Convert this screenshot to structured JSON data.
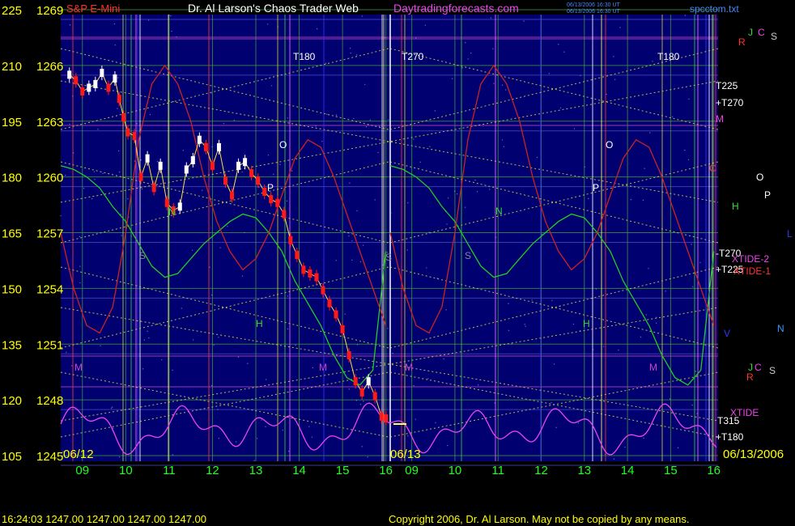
{
  "header": {
    "series_label": "S&P E-Mini",
    "title": "Dr. Al Larson's Chaos Trader Web",
    "site": "Daytradingforecasts.com",
    "stamp_1": "06/13/2006 16:30 UT",
    "stamp_2": "06/13/2006 16:30 UT",
    "file": "spcctom.txt"
  },
  "footer": {
    "quote": "16:24:03  1247.00 1247.00 1247.00 1247.00",
    "copyright": "Copyright 2006, Dr. Al Larson. May not be copied by any means."
  },
  "colors": {
    "background": "#000000",
    "plot_bg": "#000070",
    "price_up": "#ffffff",
    "price_down": "#ff1a1a",
    "electric_green": "#22cc22",
    "electric_red": "#cc2222",
    "tide_magenta": "#ee44ee",
    "grid_gold": "#d8d840",
    "day_boundary": "#ffffff",
    "axis_left_text": "#ffff00",
    "axis_bottom_text": "#22ff22"
  },
  "chart_data": {
    "type": "line",
    "title": "Dr. Al Larson's Chaos Trader Web",
    "subtitle": "S&P E-Mini",
    "y_left_ticks": [
      "225",
      "210",
      "195",
      "180",
      "165",
      "150",
      "135",
      "120",
      "105"
    ],
    "y_right_ticks": [
      "1269",
      "1266",
      "1263",
      "1260",
      "1257",
      "1254",
      "1251",
      "1248",
      "1245"
    ],
    "ylim_price": [
      1245,
      1269
    ],
    "ylim_scale": [
      105,
      225
    ],
    "x_hour_ticks": [
      "09",
      "10",
      "11",
      "12",
      "13",
      "14",
      "15",
      "16",
      "09",
      "10",
      "11",
      "12",
      "13",
      "14",
      "15",
      "16"
    ],
    "x_range_hours": [
      8.5,
      16.1
    ],
    "days": [
      "06/12",
      "06/13",
      "06/13/2006"
    ],
    "series": [
      {
        "name": "S&P E-Mini",
        "x_hours": [
          8.7,
          8.85,
          9.0,
          9.15,
          9.3,
          9.45,
          9.6,
          9.75,
          9.85,
          9.95,
          10.05,
          10.2,
          10.35,
          10.5,
          10.65,
          10.8,
          10.95,
          11.1,
          11.25,
          11.4,
          11.55,
          11.7,
          11.85,
          12.0,
          12.15,
          12.3,
          12.45,
          12.6,
          12.75,
          12.9,
          13.05,
          13.2,
          13.35,
          13.5,
          13.65,
          13.8,
          13.95,
          14.1,
          14.25,
          14.4,
          14.55,
          14.7,
          14.85,
          15.0,
          15.15,
          15.3,
          15.45,
          15.6,
          15.75,
          15.9,
          16.0
        ],
        "values": [
          1265.5,
          1265.2,
          1264.6,
          1264.8,
          1265.0,
          1265.6,
          1264.8,
          1265.3,
          1264.2,
          1263.2,
          1262.4,
          1262.2,
          1260.0,
          1261.0,
          1259.4,
          1260.6,
          1258.6,
          1258.2,
          1258.4,
          1260.4,
          1260.9,
          1262.0,
          1261.6,
          1260.6,
          1261.6,
          1259.8,
          1259.0,
          1260.6,
          1260.8,
          1260.2,
          1259.8,
          1259.2,
          1258.8,
          1258.6,
          1258.0,
          1256.6,
          1255.8,
          1255.0,
          1254.8,
          1254.6,
          1253.9,
          1253.2,
          1252.6,
          1251.8,
          1250.4,
          1249.0,
          1248.4,
          1249.0,
          1248.2,
          1247.1,
          1247.0
        ]
      },
      {
        "name": "Electric field (green)",
        "x_hours": [
          8.5,
          8.8,
          9.1,
          9.4,
          9.7,
          10.0,
          10.3,
          10.6,
          10.9,
          11.2,
          11.5,
          11.8,
          12.1,
          12.4,
          12.7,
          13.0,
          13.3,
          13.6,
          13.9,
          14.2,
          14.5,
          14.8,
          15.1,
          15.4,
          15.7,
          16.0
        ],
        "values": [
          183,
          182,
          180,
          177,
          172,
          168,
          162,
          156,
          153,
          154,
          158,
          162,
          165,
          168,
          170,
          169,
          165,
          160,
          152,
          146,
          140,
          132,
          126,
          124,
          128,
          160
        ]
      },
      {
        "name": "Electric field (red)",
        "x_hours": [
          8.5,
          8.8,
          9.1,
          9.4,
          9.7,
          10.0,
          10.3,
          10.6,
          10.9,
          11.2,
          11.5,
          11.8,
          12.1,
          12.4,
          12.7,
          13.0,
          13.3,
          13.6,
          13.9,
          14.2,
          14.5,
          14.8,
          15.1,
          15.4,
          15.7,
          16.0
        ],
        "values": [
          165,
          150,
          140,
          138,
          145,
          165,
          190,
          205,
          210,
          205,
          195,
          180,
          168,
          160,
          155,
          158,
          165,
          175,
          185,
          190,
          188,
          180,
          170,
          160,
          150,
          140
        ]
      }
    ],
    "annotations": [
      "T180",
      "T270",
      "T180",
      "T225",
      "+T270",
      "-T270",
      "+T225",
      "T315",
      "+T180",
      "M",
      "C",
      "O",
      "P",
      "H",
      "N",
      "S",
      "R",
      "J",
      "V",
      "L",
      "XTIDE",
      "XTIDE-2",
      "XTIDE-1"
    ],
    "grid": true
  }
}
